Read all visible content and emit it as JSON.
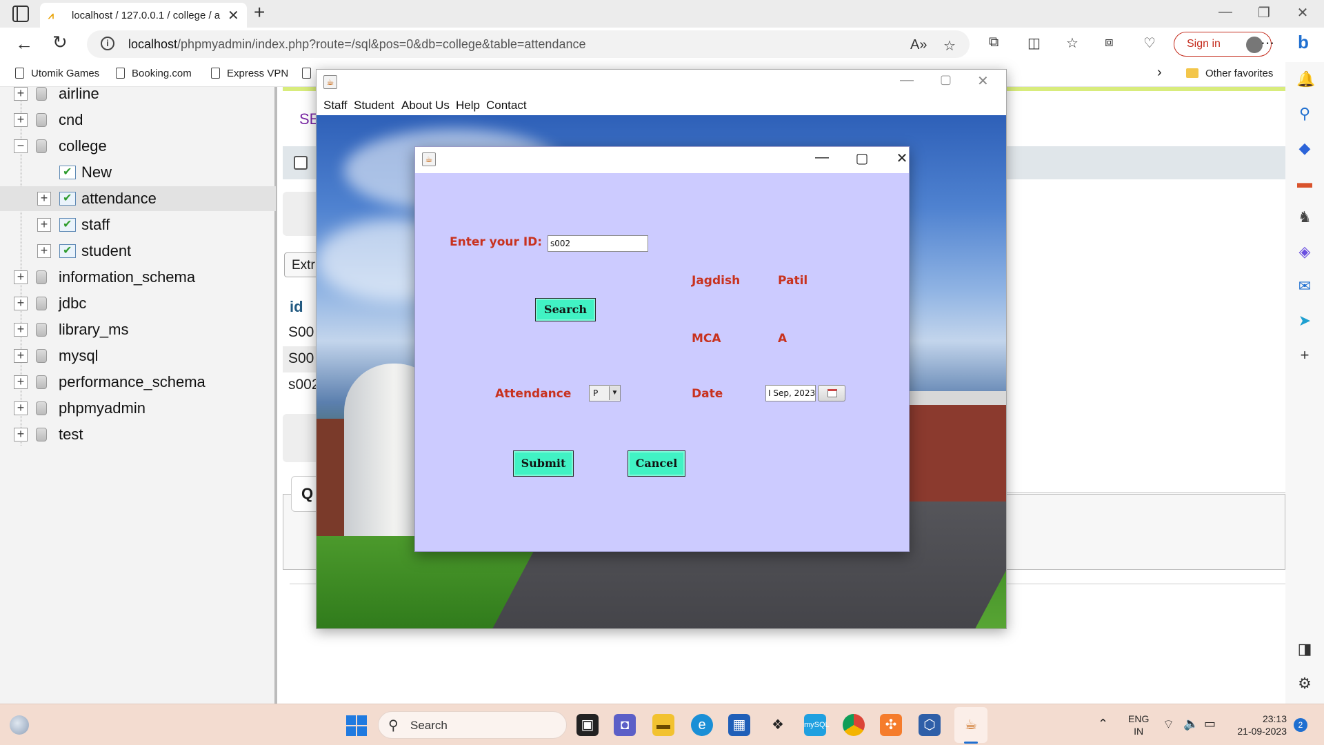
{
  "browser": {
    "tab_title": "localhost / 127.0.0.1 / college / a",
    "tab_favicon": "phpmyadmin-icon",
    "url_host": "localhost",
    "url_path": "/phpmyadmin/index.php?route=/sql&pos=0&db=college&table=attendance",
    "sign_in": "Sign in",
    "favorites": [
      {
        "label": "Utomik Games",
        "icon": "doc-icon"
      },
      {
        "label": "Booking.com",
        "icon": "doc-icon"
      },
      {
        "label": "Express VPN",
        "icon": "doc-icon"
      }
    ],
    "other_favorites": "Other favorites"
  },
  "pma": {
    "tree": [
      {
        "label": "airline",
        "type": "db"
      },
      {
        "label": "cnd",
        "type": "db"
      },
      {
        "label": "college",
        "type": "db",
        "expanded": true
      },
      {
        "label": "New",
        "type": "new"
      },
      {
        "label": "attendance",
        "type": "table",
        "selected": true
      },
      {
        "label": "staff",
        "type": "table"
      },
      {
        "label": "student",
        "type": "table"
      },
      {
        "label": "information_schema",
        "type": "db"
      },
      {
        "label": "jdbc",
        "type": "db"
      },
      {
        "label": "library_ms",
        "type": "db"
      },
      {
        "label": "mysql",
        "type": "db"
      },
      {
        "label": "performance_schema",
        "type": "db"
      },
      {
        "label": "phpmyadmin",
        "type": "db"
      },
      {
        "label": "test",
        "type": "db"
      }
    ],
    "se_link": "SE",
    "extr_button": "Extr",
    "col_header": "id",
    "rows": [
      "S00",
      "S00",
      "s002"
    ],
    "q_label": "Q"
  },
  "java_frame": {
    "menu": [
      "Staff",
      "Student",
      "About Us",
      "Help",
      "Contact"
    ]
  },
  "dialog": {
    "id_label": "Enter your ID:",
    "id_value": "s002",
    "first_name": "Jagdish",
    "last_name": "Patil",
    "course": "MCA",
    "division": "A",
    "search_button": "Search",
    "attendance_label": "Attendance",
    "attendance_value": "P",
    "date_label": "Date",
    "date_value": "I Sep, 2023",
    "submit_button": "Submit",
    "cancel_button": "Cancel",
    "label_color": "#c8321f",
    "button_color": "#41f2c4",
    "background_color": "#cccbff"
  },
  "taskbar": {
    "search": "Search",
    "lang_line1": "ENG",
    "lang_line2": "IN",
    "time": "23:13",
    "date": "21-09-2023",
    "notifications": "2"
  }
}
